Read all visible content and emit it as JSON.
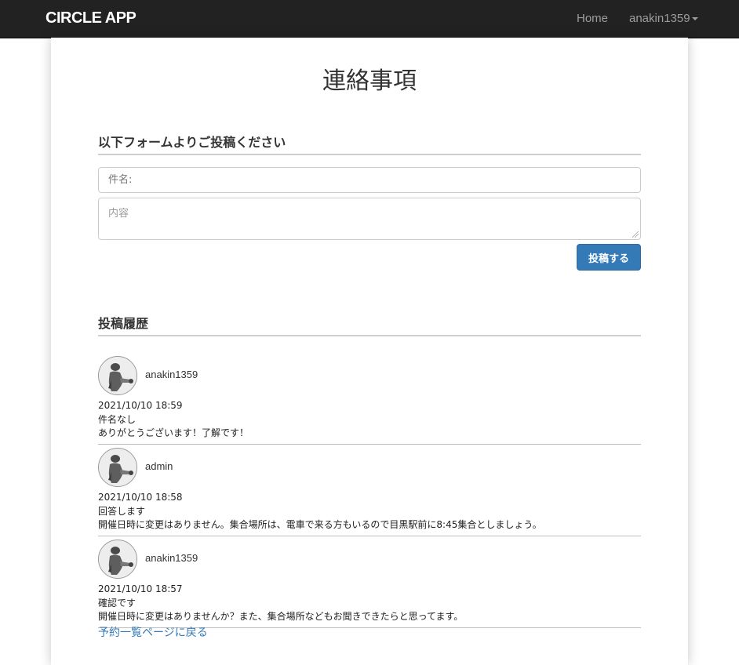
{
  "navbar": {
    "brand": "CIRCLE APP",
    "home": "Home",
    "user": "anakin1359"
  },
  "page": {
    "title": "連絡事項"
  },
  "form": {
    "heading": "以下フォームよりご投稿ください",
    "subject_placeholder": "件名:",
    "body_placeholder": "内容",
    "submit_label": "投稿する"
  },
  "history": {
    "heading": "投稿履歴",
    "posts": [
      {
        "author": "anakin1359",
        "timestamp": "2021/10/10 18:59",
        "subject": "件名なし",
        "body": "ありがとうございます！了解です！"
      },
      {
        "author": "admin",
        "timestamp": "2021/10/10 18:58",
        "subject": "回答します",
        "body": "開催日時に変更はありません。集合場所は、電車で来る方もいるので目黒駅前に8:45集合としましょう。"
      },
      {
        "author": "anakin1359",
        "timestamp": "2021/10/10 18:57",
        "subject": "確認です",
        "body": "開催日時に変更はありませんか？また、集合場所などもお聞きできたらと思ってます。"
      }
    ]
  },
  "footer": {
    "back_link": "予約一覧ページに戻る"
  },
  "colors": {
    "navbar_bg": "#222222",
    "primary": "#337ab7",
    "link": "#337ab7"
  }
}
